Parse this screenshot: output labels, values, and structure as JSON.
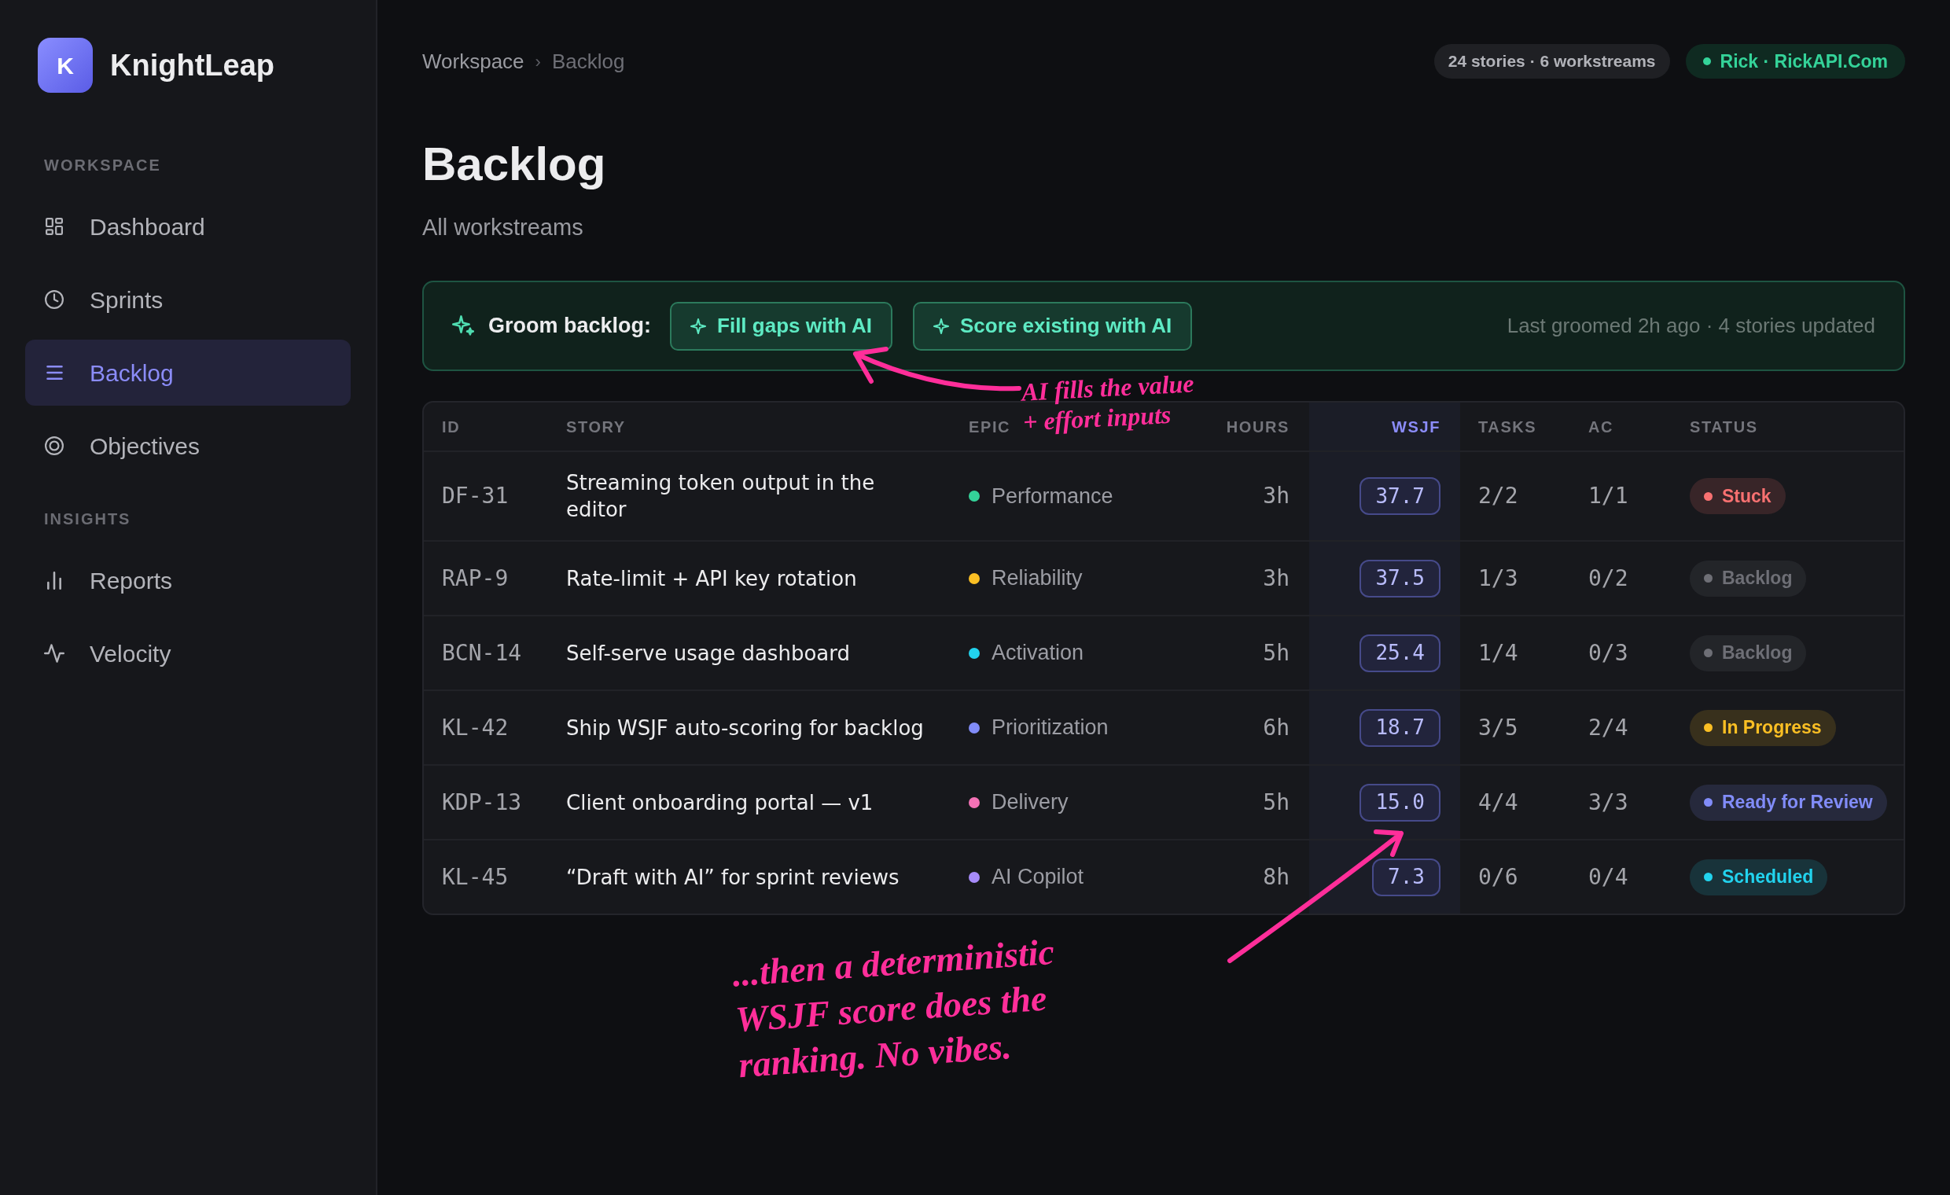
{
  "sidebar": {
    "brand": {
      "initial": "K",
      "name": "KnightLeap"
    },
    "sections": [
      {
        "label": "WORKSPACE",
        "items": [
          {
            "label": "Dashboard",
            "selected": false
          },
          {
            "label": "Sprints",
            "selected": false
          },
          {
            "label": "Backlog",
            "selected": true
          },
          {
            "label": "Objectives",
            "selected": false
          }
        ]
      },
      {
        "label": "INSIGHTS",
        "items": [
          {
            "label": "Reports",
            "selected": false
          },
          {
            "label": "Velocity",
            "selected": false
          }
        ]
      }
    ]
  },
  "breadcrumb": {
    "items": [
      "Workspace",
      "Backlog"
    ],
    "separator": "›"
  },
  "header_badges": [
    {
      "kind": "count",
      "text": "24 stories · 6 workstreams"
    },
    {
      "kind": "user",
      "text": "Rick · RickAPI.Com"
    }
  ],
  "page": {
    "title": "Backlog",
    "subtitle": "All workstreams"
  },
  "groom_bar": {
    "label": "Groom backlog:",
    "buttons": [
      "Fill gaps with AI",
      "Score existing with AI"
    ],
    "meta": "Last groomed 2h ago · 4 stories updated"
  },
  "table": {
    "columns": [
      {
        "label": "ID",
        "sorted": false
      },
      {
        "label": "STORY",
        "sorted": false
      },
      {
        "label": "EPIC",
        "sorted": false
      },
      {
        "label": "HOURS",
        "sorted": false
      },
      {
        "label": "WSJF",
        "sorted": true
      },
      {
        "label": "TASKS",
        "sorted": false
      },
      {
        "label": "AC",
        "sorted": false
      },
      {
        "label": "STATUS",
        "sorted": false
      }
    ],
    "rows": [
      {
        "id": "DF-31",
        "story": "Streaming token output in the editor",
        "epic": {
          "name": "Performance",
          "color": "#34d399"
        },
        "hours": "3h",
        "wsjf": "37.7",
        "tasks": "2/2",
        "ac": "1/1",
        "status": {
          "label": "Stuck",
          "color": "#f87171"
        }
      },
      {
        "id": "RAP-9",
        "story": "Rate-limit + API key rotation",
        "epic": {
          "name": "Reliability",
          "color": "#fbbf24"
        },
        "hours": "3h",
        "wsjf": "37.5",
        "tasks": "1/3",
        "ac": "0/2",
        "status": {
          "label": "Backlog",
          "color": "#6e6f76"
        }
      },
      {
        "id": "BCN-14",
        "story": "Self-serve usage dashboard",
        "epic": {
          "name": "Activation",
          "color": "#22d3ee"
        },
        "hours": "5h",
        "wsjf": "25.4",
        "tasks": "1/4",
        "ac": "0/3",
        "status": {
          "label": "Backlog",
          "color": "#6e6f76"
        }
      },
      {
        "id": "KL-42",
        "story": "Ship WSJF auto-scoring for backlog",
        "epic": {
          "name": "Prioritization",
          "color": "#818cf8"
        },
        "hours": "6h",
        "wsjf": "18.7",
        "tasks": "3/5",
        "ac": "2/4",
        "status": {
          "label": "In Progress",
          "color": "#fbbf24"
        }
      },
      {
        "id": "KDP-13",
        "story": "Client onboarding portal — v1",
        "epic": {
          "name": "Delivery",
          "color": "#f472b6"
        },
        "hours": "5h",
        "wsjf": "15.0",
        "tasks": "4/4",
        "ac": "3/3",
        "status": {
          "label": "Ready for Review",
          "color": "#818cf8"
        }
      },
      {
        "id": "KL-45",
        "story": "“Draft with AI” for sprint reviews",
        "epic": {
          "name": "AI Copilot",
          "color": "#a78bfa"
        },
        "hours": "8h",
        "wsjf": "7.3",
        "tasks": "0/6",
        "ac": "0/4",
        "status": {
          "label": "Scheduled",
          "color": "#22d3ee"
        }
      }
    ]
  },
  "annotations": [
    {
      "text": "AI fills the value\n+ effort inputs"
    },
    {
      "text": "...then a deterministic\nWSJF score does the\nranking. No vibes."
    }
  ]
}
